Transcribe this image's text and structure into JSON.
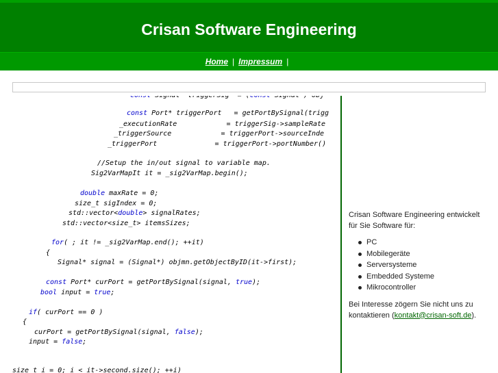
{
  "header": {
    "title": "Crisan Software Engineering",
    "nav": [
      {
        "label": "Home"
      },
      {
        "label": "Impressum"
      }
    ],
    "separator": "|"
  },
  "sidebar": {
    "intro": "Crisan Software Engineering entwickelt für Sie Software für:",
    "items": [
      "PC",
      "Mobilegeräte",
      "Serversysteme",
      "Embedded Systeme",
      "Mikrocontroller"
    ],
    "contact_prefix": "Bei Interesse zögern Sie nicht uns zu kontaktieren (",
    "contact_email": "kontakt@crisan-soft.de",
    "contact_suffix": ")."
  },
  "code_lines": [
    "const Signal* triggerSig  = (const Signal*) obj",
    "const Port* triggerPort   = getPortBySignal(trigg",
    "_executionRate            = triggerSig->sampleRate",
    "_triggerSource            = triggerPort->sourceInde",
    "_triggerPort              = triggerPort->portNumber()",
    "//Setup the in/out signal to variable map.",
    "Sig2VarMapIt it = _sig2VarMap.begin();",
    "double maxRate = 0;",
    "size_t sigIndex = 0;",
    "std::vector<double> signalRates;",
    "std::vector<size_t> itemsSizes;",
    "for( ; it != _sig2VarMap.end(); ++it)",
    "{",
    "Signal* signal = (Signal*) objmn.getObjectByID(it->first);",
    "const Port* curPort = getPortBySignal(signal, true);",
    "bool input = true;",
    "if( curPort == 0 )",
    "{",
    "curPort = getPortBySignal(signal, false);",
    "input = false;",
    "size_t i = 0; i < it->second.size(); ++i)"
  ]
}
